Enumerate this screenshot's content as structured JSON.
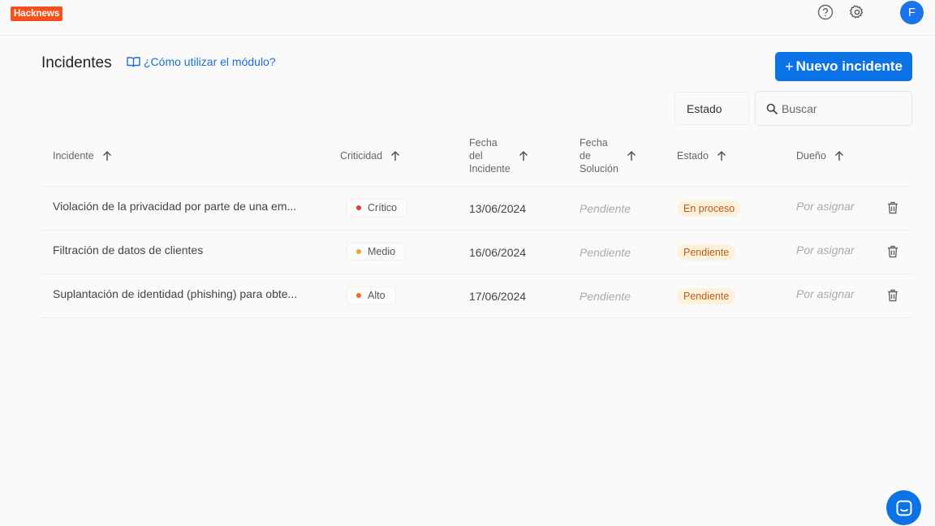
{
  "app": {
    "logo_text": "Hacknews",
    "avatar_initial": "F"
  },
  "page": {
    "title": "Incidentes",
    "help_link": "¿Cómo utilizar el módulo?"
  },
  "actions": {
    "new_incident_plus": "+",
    "new_incident_label": "Nuevo incidente"
  },
  "filters": {
    "estado_label": "Estado",
    "search_placeholder": "Buscar"
  },
  "table": {
    "headers": {
      "incident": "Incidente",
      "criticality": "Criticidad",
      "date_incident_1": "Fecha",
      "date_incident_2": "del",
      "date_incident_3": "Incidente",
      "date_solution_1": "Fecha",
      "date_solution_2": "de",
      "date_solution_3": "Solución",
      "status": "Estado",
      "owner": "Dueño"
    },
    "rows": [
      {
        "incident": "Violación de la privacidad por parte de una em...",
        "criticality": "Crítico",
        "criticality_color": "#e53935",
        "date": "13/06/2024",
        "solution_date": "Pendiente",
        "status": "En proceso",
        "owner": "Por asignar"
      },
      {
        "incident": "Filtración de datos de clientes",
        "criticality": "Medio",
        "criticality_color": "#f0a030",
        "date": "16/06/2024",
        "solution_date": "Pendiente",
        "status": "Pendiente",
        "owner": "Por asignar"
      },
      {
        "incident": "Suplantación de identidad (phishing) para obte...",
        "criticality": "Alto",
        "criticality_color": "#f46a20",
        "date": "17/06/2024",
        "solution_date": "Pendiente",
        "status": "Pendiente",
        "owner": "Por asignar"
      }
    ]
  },
  "colors": {
    "primary": "#0c73e6",
    "logo_bg": "#f4511e",
    "status_bg": "#fdf3dc",
    "status_text": "#c5561a"
  },
  "icons": [
    "help-icon",
    "gear-icon",
    "book-icon",
    "search-icon",
    "sort-arrow-up-icon",
    "trash-icon",
    "chat-icon"
  ]
}
